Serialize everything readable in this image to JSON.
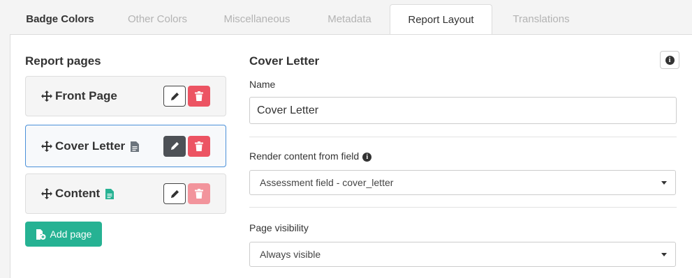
{
  "tabs": [
    {
      "label": "Badge Colors"
    },
    {
      "label": "Other Colors"
    },
    {
      "label": "Miscellaneous"
    },
    {
      "label": "Metadata"
    },
    {
      "label": "Report Layout"
    },
    {
      "label": "Translations"
    }
  ],
  "active_tab": "Report Layout",
  "report_pages": {
    "heading": "Report pages",
    "pages": [
      {
        "name": "Front Page",
        "icon": "none",
        "selected": false,
        "delete_enabled": true
      },
      {
        "name": "Cover Letter",
        "icon": "document-icon-gray",
        "selected": true,
        "delete_enabled": true
      },
      {
        "name": "Content",
        "icon": "document-icon-green",
        "selected": false,
        "delete_enabled": false
      }
    ],
    "add_label": "Add page"
  },
  "editor": {
    "title": "Cover Letter",
    "name_label": "Name",
    "name_value": "Cover Letter",
    "render_label": "Render content from field",
    "render_value": "Assessment field - cover_letter",
    "visibility_label": "Page visibility",
    "visibility_value": "Always visible"
  },
  "colors": {
    "delete": "#ec5463",
    "delete_disabled": "#f2949c",
    "add": "#26b293",
    "selected_border": "#4a90d9",
    "doc_gray": "#6c757d",
    "doc_green": "#26b293"
  }
}
